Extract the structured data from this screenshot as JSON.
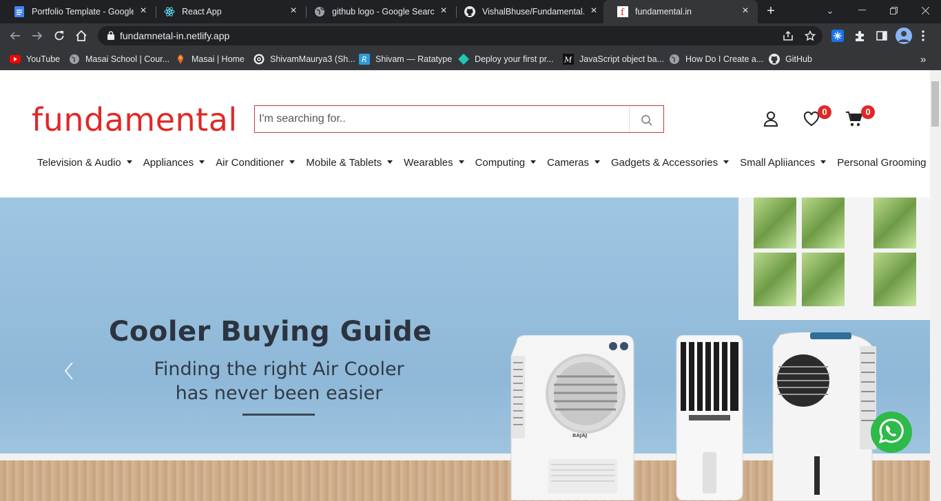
{
  "browser": {
    "tabs": [
      {
        "title": "Portfolio Template - Google",
        "favicon": "google-docs-icon"
      },
      {
        "title": "React App",
        "favicon": "react-icon"
      },
      {
        "title": "github logo - Google Search",
        "favicon": "globe-icon"
      },
      {
        "title": "VishalBhuse/Fundamental.in",
        "favicon": "github-icon"
      },
      {
        "title": "fundamental.in",
        "favicon": "fundamental-f-icon",
        "active": true
      }
    ],
    "url": "fundamnetal-in.netlify.app",
    "bookmarks": [
      {
        "label": "YouTube",
        "icon": "youtube-icon"
      },
      {
        "label": "Masai School | Cour...",
        "icon": "globe-icon"
      },
      {
        "label": "Masai | Home",
        "icon": "masai-icon"
      },
      {
        "label": "ShivamMaurya3 (Sh...",
        "icon": "codeforces-icon"
      },
      {
        "label": "Shivam — Ratatype",
        "icon": "ratatype-icon"
      },
      {
        "label": "Deploy your first pr...",
        "icon": "netlify-icon"
      },
      {
        "label": "JavaScript object ba...",
        "icon": "medium-icon"
      },
      {
        "label": "How Do I Create a...",
        "icon": "globe-icon"
      },
      {
        "label": "GitHub",
        "icon": "github-icon"
      }
    ]
  },
  "site": {
    "logo": "fundamental",
    "search_placeholder": "I'm searching for..",
    "wishlist_count": "0",
    "cart_count": "0",
    "menu": [
      "Television & Audio",
      "Appliances",
      "Air Conditioner",
      "Mobile & Tablets",
      "Wearables",
      "Computing",
      "Cameras",
      "Gadgets & Accessories",
      "Small Apliiances",
      "Personal Grooming"
    ]
  },
  "hero": {
    "title": "Cooler Buying Guide",
    "subtitle_line1": "Finding the right Air Cooler",
    "subtitle_line2": "has never been easier",
    "brand_mark": "BAJAJ"
  },
  "colors": {
    "brand_red": "#e02826",
    "whatsapp_green": "#2dba49",
    "hero_blue": "#9fc6e2"
  }
}
